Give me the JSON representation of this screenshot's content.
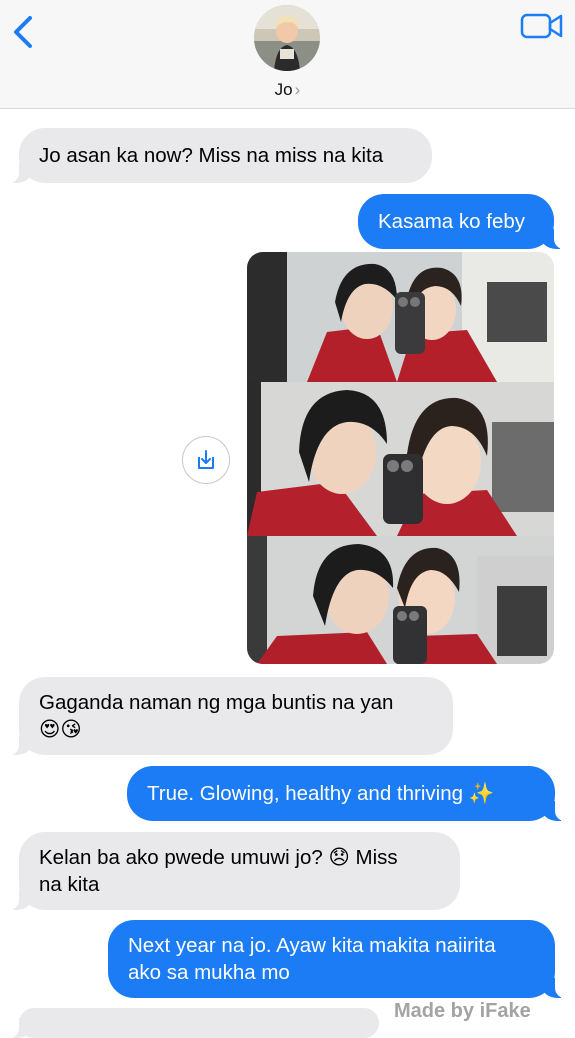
{
  "header": {
    "contact_name": "Jo",
    "name_chevron": "›",
    "back_icon": "chevron-left-icon",
    "video_icon": "video-camera-icon",
    "accent_color": "#1b7cf5"
  },
  "messages": [
    {
      "from": "contact",
      "text": "Jo asan ka now? Miss na miss na kita"
    },
    {
      "from": "me",
      "text": "Kasama ko feby"
    },
    {
      "from": "contact",
      "type": "photo"
    },
    {
      "from": "contact",
      "text_line1": "Gaganda naman ng mga buntis na yan",
      "text_line2": "😍😘"
    },
    {
      "from": "me",
      "text": "True. Glowing, healthy and thriving ✨"
    },
    {
      "from": "contact",
      "text_line1": "Kelan ba ako pwede umuwi jo? 😞 Miss",
      "text_line2": "na kita"
    },
    {
      "from": "me",
      "text_line1": "Next year na jo. Ayaw kita makita naiirita",
      "text_line2": "ako sa mukha mo"
    }
  ],
  "watermark": "Made by iFake",
  "colors": {
    "received_bubble": "#e9e9eb",
    "sent_bubble": "#1b7cf5",
    "header_bg": "#f7f7f7"
  }
}
